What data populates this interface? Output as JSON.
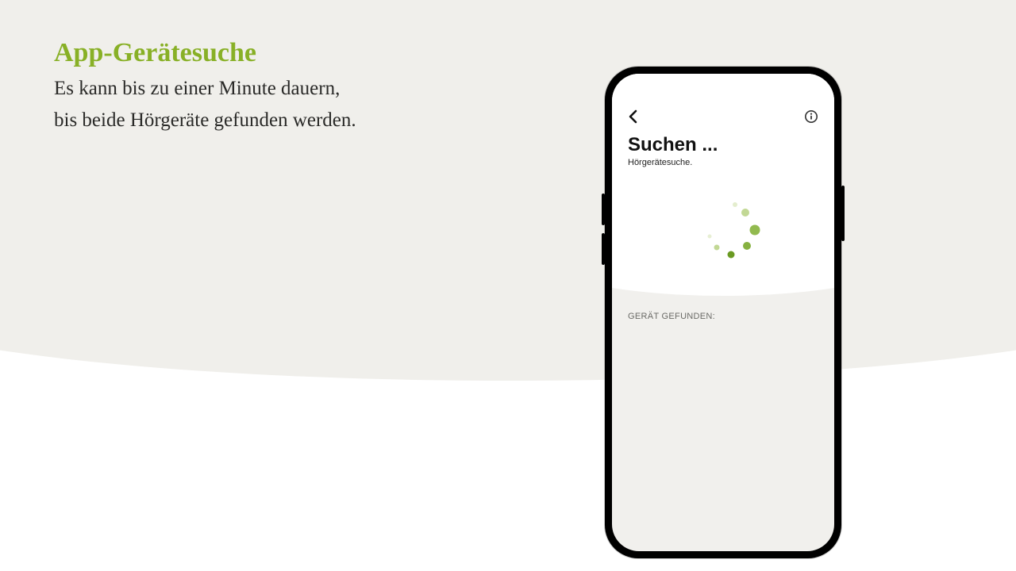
{
  "page": {
    "heading": "App-Gerätesuche",
    "description_line1": "Es kann bis zu einer Minute dauern,",
    "description_line2": "bis beide Hörgeräte gefunden werden."
  },
  "app": {
    "title": "Suchen ...",
    "subtitle": "Hörgerätesuche.",
    "found_label": "GERÄT GEFUNDEN:"
  },
  "colors": {
    "accent": "#88b026",
    "bg_upper": "#f0efeb",
    "phone_bg_lower": "#f1f0ed"
  }
}
